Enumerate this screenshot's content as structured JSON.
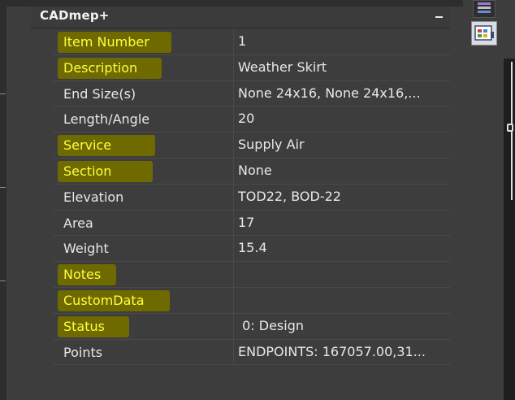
{
  "panel": {
    "title": "CADmep+",
    "collapse_icon": "minus-icon"
  },
  "properties": [
    {
      "name": "Item Number",
      "value": "1",
      "highlighted": true
    },
    {
      "name": "Description",
      "value": "Weather Skirt",
      "highlighted": true
    },
    {
      "name": "End Size(s)",
      "value": "None 24x16, None 24x16,...",
      "highlighted": false
    },
    {
      "name": "Length/Angle",
      "value": "20",
      "highlighted": false
    },
    {
      "name": "Service",
      "value": "Supply Air",
      "highlighted": true
    },
    {
      "name": "Section",
      "value": "None",
      "highlighted": true
    },
    {
      "name": "Elevation",
      "value": "TOD22, BOD-22",
      "highlighted": false
    },
    {
      "name": "Area",
      "value": "17",
      "highlighted": false
    },
    {
      "name": "Weight",
      "value": "15.4",
      "highlighted": false
    },
    {
      "name": "Notes",
      "value": "",
      "highlighted": true
    },
    {
      "name": "CustomData",
      "value": "",
      "highlighted": true
    },
    {
      "name": "Status",
      "value": " 0: Design",
      "highlighted": true
    },
    {
      "name": "Points",
      "value": "ENDPOINTS: 167057.00,31...",
      "highlighted": false
    }
  ],
  "icons": {
    "toolbar_1": "layer-properties-icon",
    "toolbar_2": "palette-icon"
  },
  "colors": {
    "background": "#3d3d3d",
    "highlight": "#6e6a00",
    "highlight_text": "#ffff3a",
    "text": "#e8e8e8"
  }
}
